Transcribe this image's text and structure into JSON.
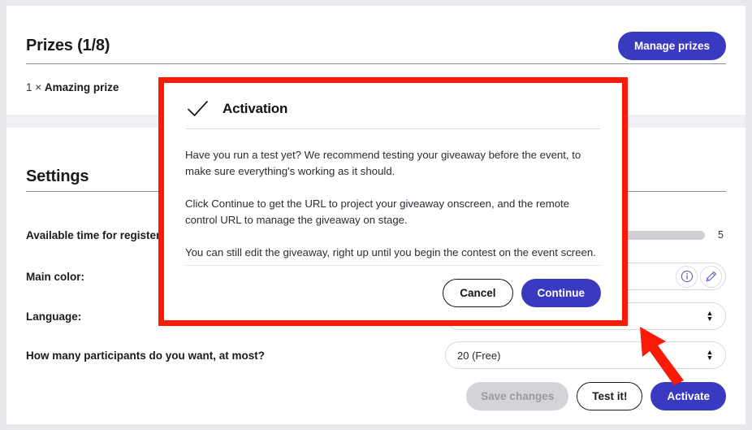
{
  "prizes": {
    "title": "Prizes (1/8)",
    "manage_button": "Manage prizes",
    "items": [
      {
        "qty": "1 × ",
        "name": "Amazing prize"
      }
    ]
  },
  "settings": {
    "title": "Settings",
    "rows": [
      {
        "label": "Available time for register",
        "type": "slider",
        "value": "5"
      },
      {
        "label": "Main color:",
        "type": "color",
        "icons": [
          "info-icon",
          "pencil-icon"
        ]
      },
      {
        "label": "Language:",
        "type": "select",
        "value": ""
      },
      {
        "label": "How many participants do you want, at most?",
        "type": "select",
        "value": "20 (Free)"
      }
    ],
    "actions": {
      "save": "Save changes",
      "test": "Test it!",
      "activate": "Activate"
    }
  },
  "modal": {
    "icon": "checkmark-icon",
    "title": "Activation",
    "paragraphs": [
      "Have you run a test yet? We recommend testing your giveaway before the event, to make sure everything's working as it should.",
      "Click Continue to get the URL to project your giveaway onscreen, and the remote control URL to manage the giveaway on stage.",
      "You can still edit the giveaway, right up until you begin the contest on the event screen."
    ],
    "cancel_label": "Cancel",
    "continue_label": "Continue"
  },
  "annotation": {
    "highlight_color": "#f91a08",
    "arrow": "up-left-arrow"
  },
  "colors": {
    "accent": "#3a3ac0",
    "highlight": "#f91a08",
    "text": "#1b1b1f",
    "band": "#eff0f3"
  }
}
